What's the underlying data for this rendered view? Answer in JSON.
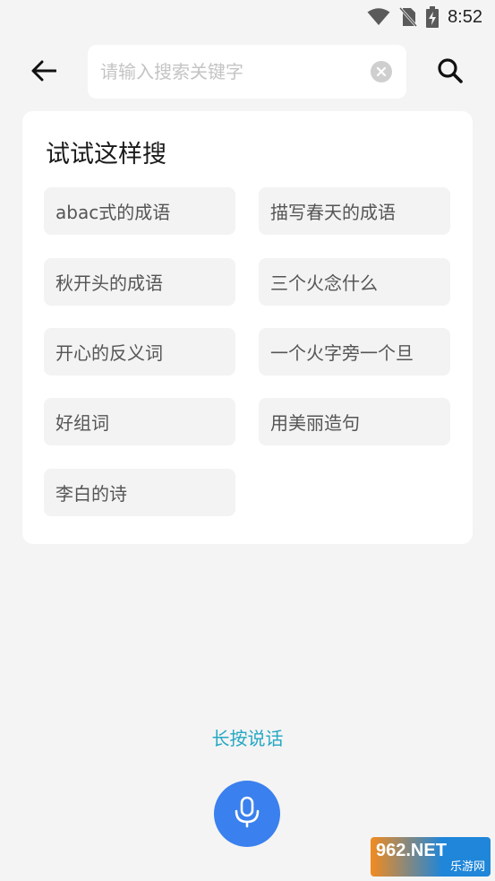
{
  "status_bar": {
    "time": "8:52",
    "icons": [
      "wifi-icon",
      "no-sim-icon",
      "battery-charging-icon"
    ]
  },
  "header": {
    "back_icon": "arrow-left-icon",
    "search": {
      "value": "",
      "placeholder": "请输入搜索关键字",
      "clear_icon": "clear-circle-icon"
    },
    "search_icon": "magnifier-icon"
  },
  "suggestions": {
    "title": "试试这样搜",
    "items": [
      "abac式的成语",
      "描写春天的成语",
      "秋开头的成语",
      "三个火念什么",
      "开心的反义词",
      "一个火字旁一个旦",
      "好组词",
      "用美丽造句",
      "李白的诗"
    ]
  },
  "voice": {
    "hold_label": "长按说话",
    "mic_icon": "microphone-icon"
  },
  "watermark": {
    "brand": "962.NET",
    "site": "乐游网"
  },
  "colors": {
    "accent": "#3a80ee",
    "hint_text": "#25a8c5",
    "background": "#f4f4f4"
  }
}
